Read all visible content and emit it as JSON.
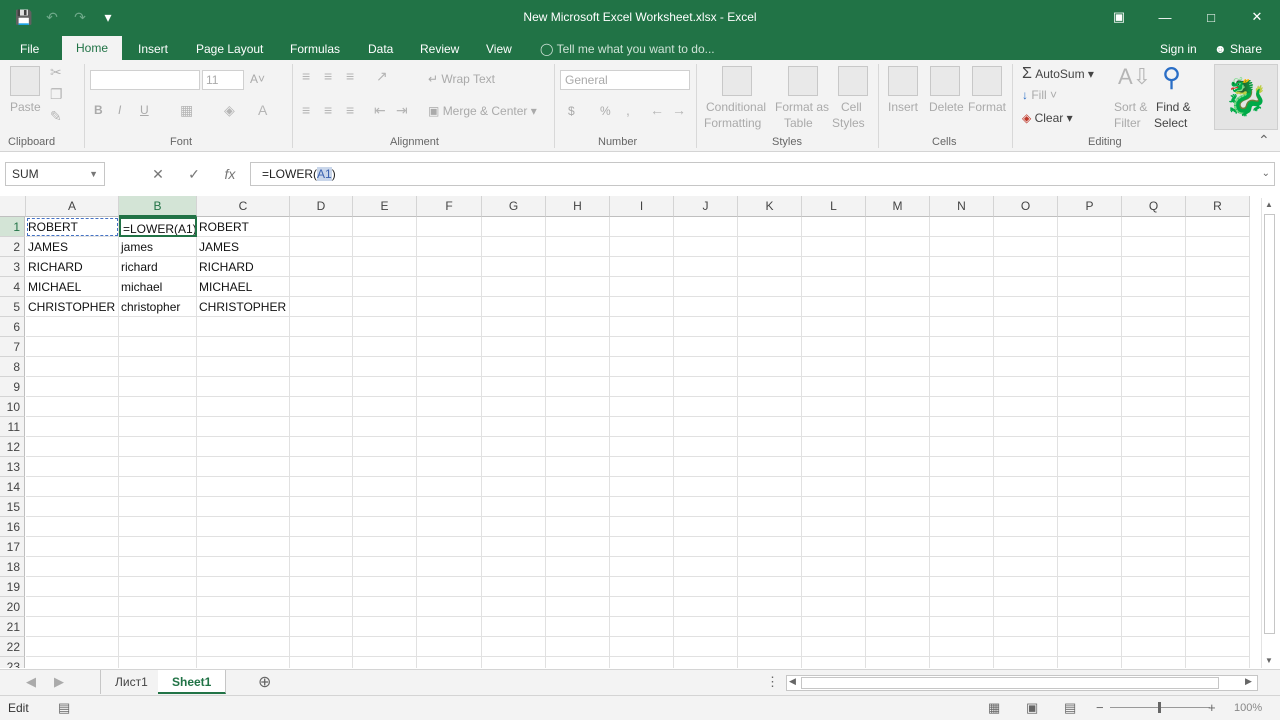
{
  "window": {
    "title": "New Microsoft Excel Worksheet.xlsx - Excel",
    "controls": [
      "restore-ribbon-icon",
      "minimize-icon",
      "maximize-icon",
      "close-icon"
    ]
  },
  "tabs": [
    "File",
    "Home",
    "Insert",
    "Page Layout",
    "Formulas",
    "Data",
    "Review",
    "View"
  ],
  "active_tab": "Home",
  "tell_me": "Tell me what you want to do...",
  "sign_in": "Sign in",
  "share": "Share",
  "ribbon": {
    "clipboard": {
      "label": "Clipboard",
      "paste": "Paste"
    },
    "font": {
      "label": "Font",
      "size": "11",
      "bold": "B",
      "italic": "I",
      "underline": "U"
    },
    "alignment": {
      "label": "Alignment",
      "wrap": "Wrap Text",
      "merge": "Merge & Center"
    },
    "number": {
      "label": "Number",
      "format": "General",
      "currency": "$",
      "percent": "%"
    },
    "styles": {
      "label": "Styles",
      "cond1": "Conditional",
      "cond2": "Formatting",
      "fmt1": "Format as",
      "fmt2": "Table",
      "cell1": "Cell",
      "cell2": "Styles"
    },
    "cells": {
      "label": "Cells",
      "insert": "Insert",
      "delete": "Delete",
      "format": "Format"
    },
    "editing": {
      "label": "Editing",
      "autosum": "AutoSum",
      "fill": "Fill",
      "clear": "Clear",
      "sort1": "Sort &",
      "sort2": "Filter",
      "find1": "Find &",
      "find2": "Select"
    }
  },
  "formula_bar": {
    "name_box": "SUM",
    "cancel": "✕",
    "enter": "✓",
    "fx": "fx",
    "formula_prefix": "=LOWER(",
    "formula_ref": "A1",
    "formula_suffix": ")"
  },
  "columns": [
    "A",
    "B",
    "C",
    "D",
    "E",
    "F",
    "G",
    "H",
    "I",
    "J",
    "K",
    "L",
    "M",
    "N",
    "O",
    "P",
    "Q",
    "R"
  ],
  "rows": [
    "1",
    "2",
    "3",
    "4",
    "5",
    "6",
    "7",
    "8",
    "9",
    "10",
    "11",
    "12",
    "13",
    "14",
    "15",
    "16",
    "17",
    "18",
    "19",
    "20",
    "21",
    "22",
    "23"
  ],
  "cells": [
    [
      "ROBERT",
      "=LOWER(A1)",
      "ROBERT"
    ],
    [
      "JAMES",
      "james",
      "JAMES"
    ],
    [
      "RICHARD",
      "richard",
      "RICHARD"
    ],
    [
      "MICHAEL",
      "michael",
      "MICHAEL"
    ],
    [
      "CHRISTOPHER",
      "christopher",
      "CHRISTOPHER"
    ]
  ],
  "selected_column": "B",
  "selected_row": "1",
  "sheets": [
    "Лист1",
    "Sheet1"
  ],
  "active_sheet": "Sheet1",
  "status": {
    "mode": "Edit",
    "zoom": "100%"
  },
  "accent": "#217346"
}
